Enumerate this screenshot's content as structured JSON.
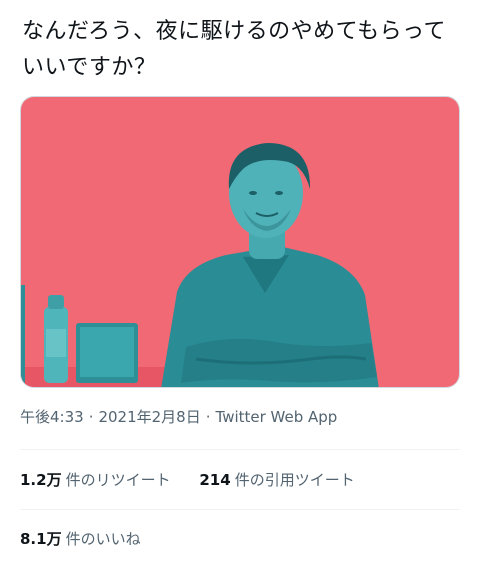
{
  "tweet": {
    "text": "なんだろう、夜に駆けるのやめてもらっていいですか？",
    "image_alt": "",
    "meta": {
      "time": "午後4:33",
      "separator": "·",
      "date": "2021年2月8日",
      "app": "Twitter Web App"
    },
    "stats": {
      "retweets": {
        "count": "1.2万",
        "label": "件のリツイート"
      },
      "quotes": {
        "count": "214",
        "label": "件の引用ツイート"
      },
      "likes": {
        "count": "8.1万",
        "label": "件のいいね"
      }
    }
  },
  "colors": {
    "image_background": "#f0636e",
    "image_figure": "#2f9ba3",
    "text_primary": "#0f1419",
    "text_secondary": "#536471",
    "divider": "#eff3f4"
  },
  "icons": {
    "media": "photo"
  }
}
